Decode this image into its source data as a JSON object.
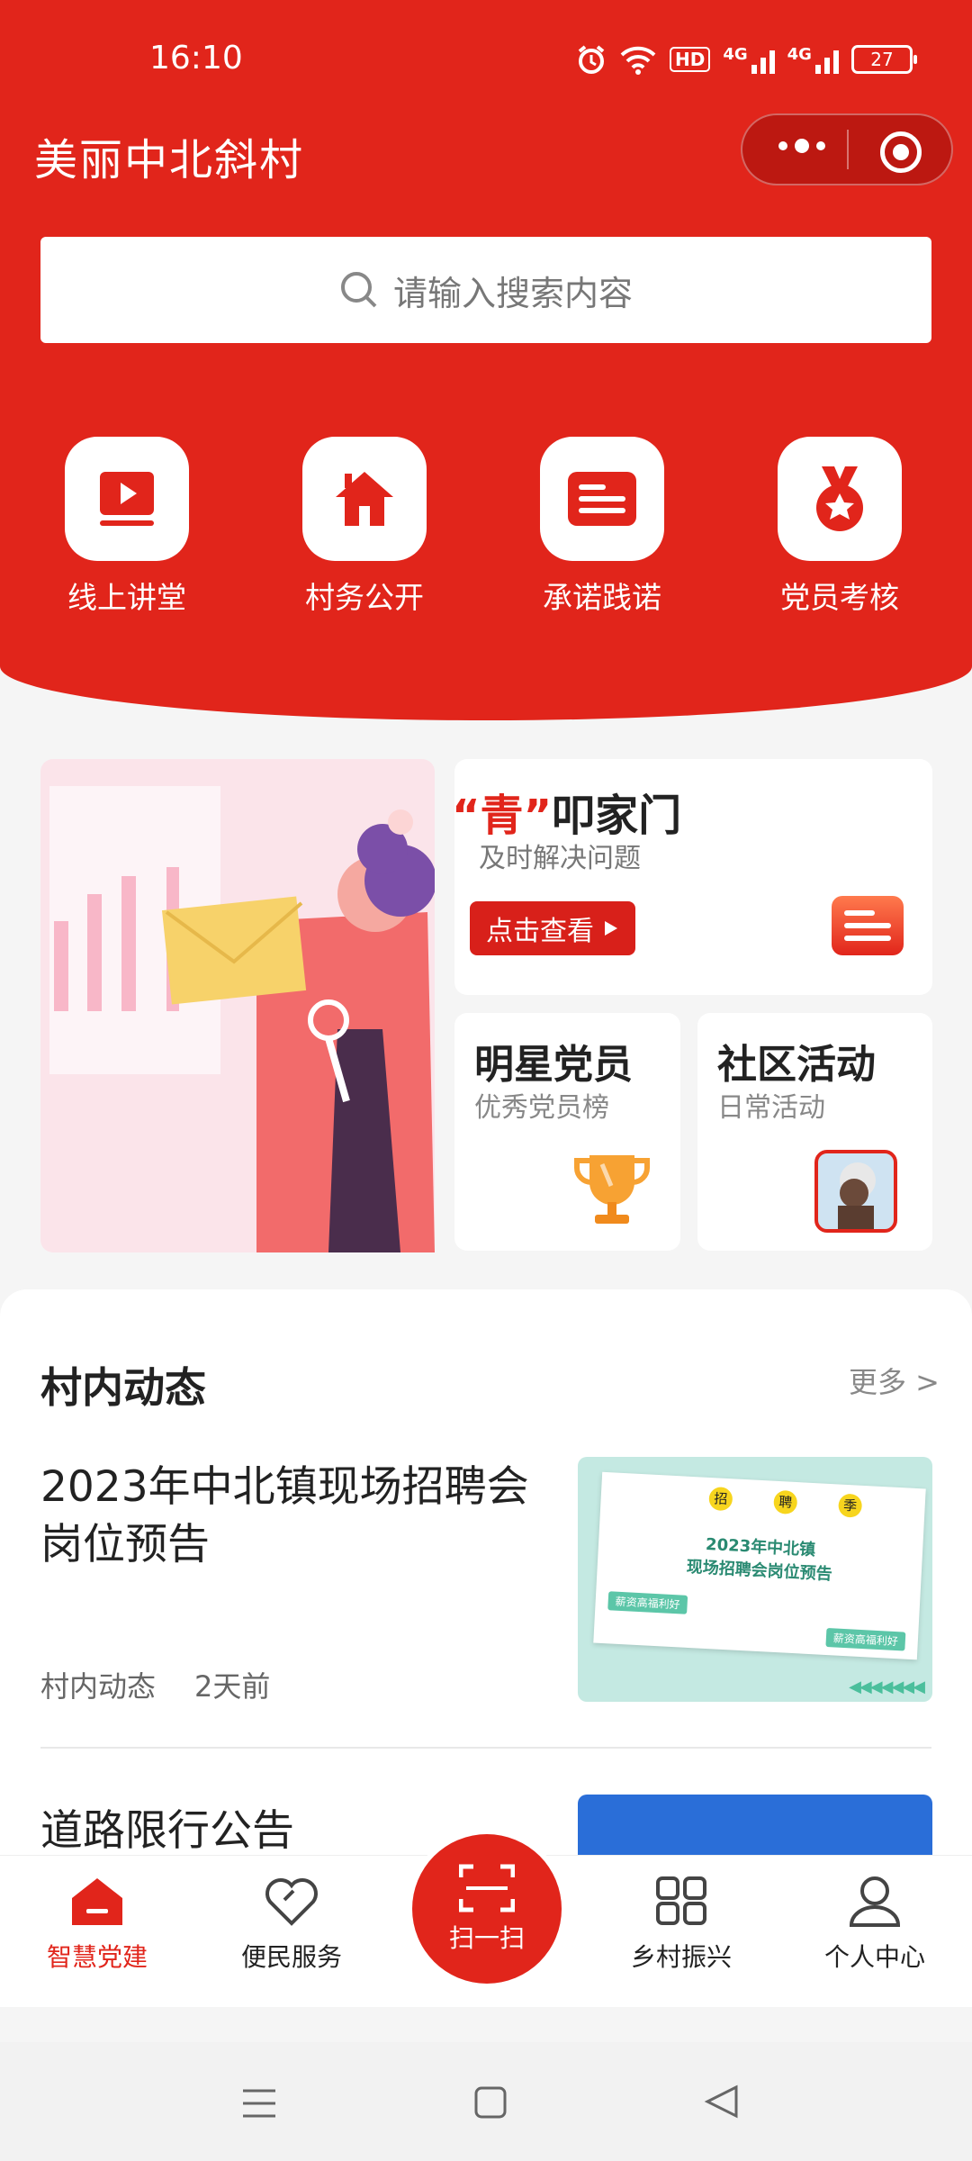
{
  "status_bar": {
    "time": "16:10",
    "network_badge": "HD",
    "net1": "4G",
    "net2": "4G",
    "battery": "27"
  },
  "header": {
    "title": "美丽中北斜村"
  },
  "search": {
    "placeholder": "请输入搜索内容"
  },
  "quick_actions": [
    {
      "label": "线上讲堂",
      "icon": "video-icon"
    },
    {
      "label": "村务公开",
      "icon": "house-icon"
    },
    {
      "label": "承诺践诺",
      "icon": "list-card-icon"
    },
    {
      "label": "党员考核",
      "icon": "medal-icon"
    }
  ],
  "features": {
    "qing": {
      "quote_open": "“",
      "highlight": "青",
      "quote_close": "”",
      "rest": "叩家门",
      "subtitle": "及时解决问题",
      "button": "点击查看"
    },
    "star": {
      "title": "明星党员",
      "subtitle": "优秀党员榜"
    },
    "activity": {
      "title": "社区活动",
      "subtitle": "日常活动"
    }
  },
  "news": {
    "heading": "村内动态",
    "more": "更多 >",
    "items": [
      {
        "title": "2023年中北镇现场招聘会岗位预告",
        "category": "村内动态",
        "time": "2天前",
        "thumb": {
          "tags": [
            "招",
            "聘",
            "季"
          ],
          "line1": "2023年中北镇",
          "line2": "现场招聘会岗位预告",
          "chip": "薪资高福利好"
        }
      },
      {
        "title": "道路限行公告"
      }
    ]
  },
  "tabbar": [
    {
      "label": "智慧党建",
      "icon": "house-icon",
      "active": true
    },
    {
      "label": "便民服务",
      "icon": "heart-icon",
      "active": false
    },
    {
      "label": "扫一扫",
      "icon": "scan-icon",
      "active": false
    },
    {
      "label": "乡村振兴",
      "icon": "grid-icon",
      "active": false
    },
    {
      "label": "个人中心",
      "icon": "person-icon",
      "active": false
    }
  ],
  "colors": {
    "primary_red": "#e1251b",
    "background": "#f5f5f5"
  }
}
